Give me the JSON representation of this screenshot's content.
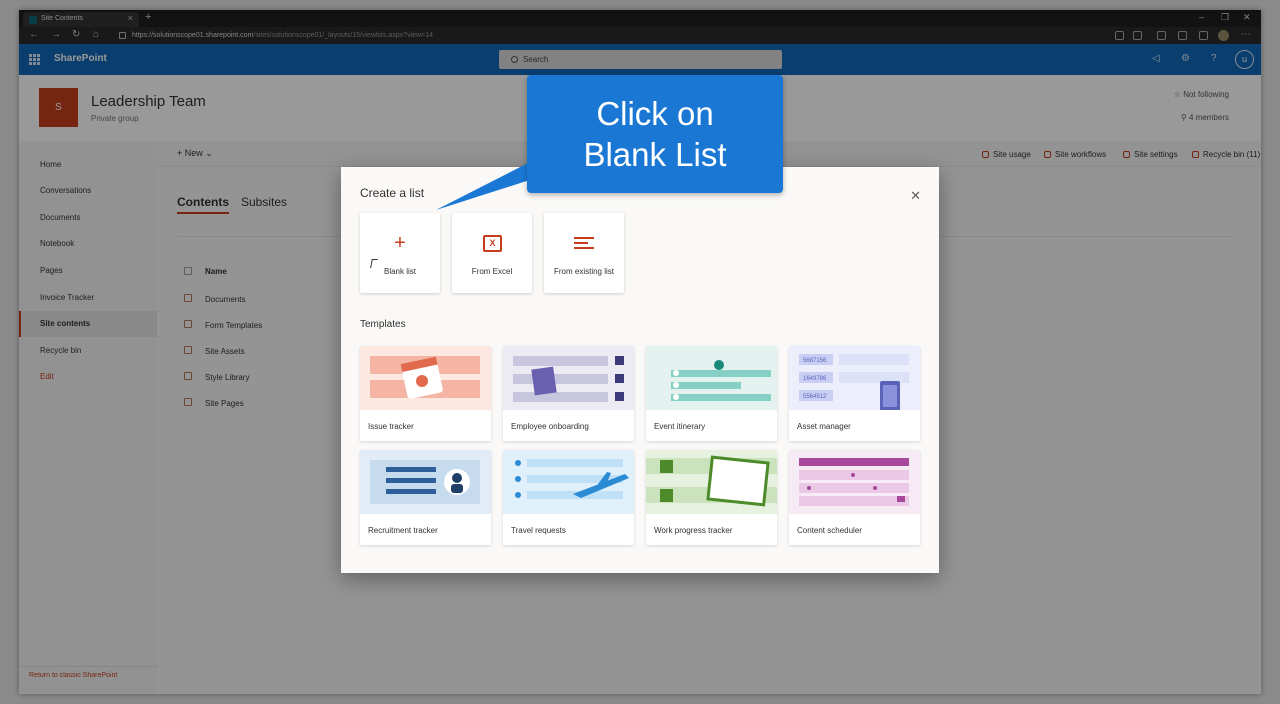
{
  "browser": {
    "tab_title": "Site Contents",
    "url_host": "https://solutionscope01.sharepoint.com",
    "url_path": "/sites/solutionscope01/_layouts/15/viewlsts.aspx?view=14"
  },
  "suite": {
    "brand": "SharePoint",
    "search_placeholder": "Search",
    "user_initial": "u"
  },
  "site": {
    "logo_letter": "S",
    "title": "Leadership Team",
    "subtitle": "Private group",
    "follow": "Not following",
    "members": "4 members"
  },
  "leftnav": {
    "items": [
      "Home",
      "Conversations",
      "Documents",
      "Notebook",
      "Pages",
      "Invoice Tracker",
      "Site contents",
      "Recycle bin",
      "Edit"
    ],
    "active": "Site contents",
    "return_link": "Return to classic SharePoint"
  },
  "commandbar": {
    "new_label": "New",
    "site_usage": "Site usage",
    "site_workflows": "Site workflows",
    "site_settings": "Site settings",
    "recycle_bin": "Recycle bin (11)"
  },
  "contents": {
    "tabs": [
      "Contents",
      "Subsites"
    ],
    "column_name": "Name",
    "rows": [
      "Documents",
      "Form Templates",
      "Site Assets",
      "Style Library",
      "Site Pages"
    ]
  },
  "dialog": {
    "title": "Create a list",
    "create_options": [
      "Blank list",
      "From Excel",
      "From existing list"
    ],
    "templates_heading": "Templates",
    "templates": [
      "Issue tracker",
      "Employee onboarding",
      "Event itinerary",
      "Asset manager",
      "Recruitment tracker",
      "Travel requests",
      "Work progress tracker",
      "Content scheduler"
    ],
    "asset_numbers": [
      "5687156",
      "1649786",
      "5564512"
    ]
  },
  "callout": {
    "line1": "Click on",
    "line2": "Blank List"
  },
  "colors": {
    "suite_blue": "#1168b9",
    "accent": "#c43e1c",
    "callout_blue": "#1a78d4"
  }
}
